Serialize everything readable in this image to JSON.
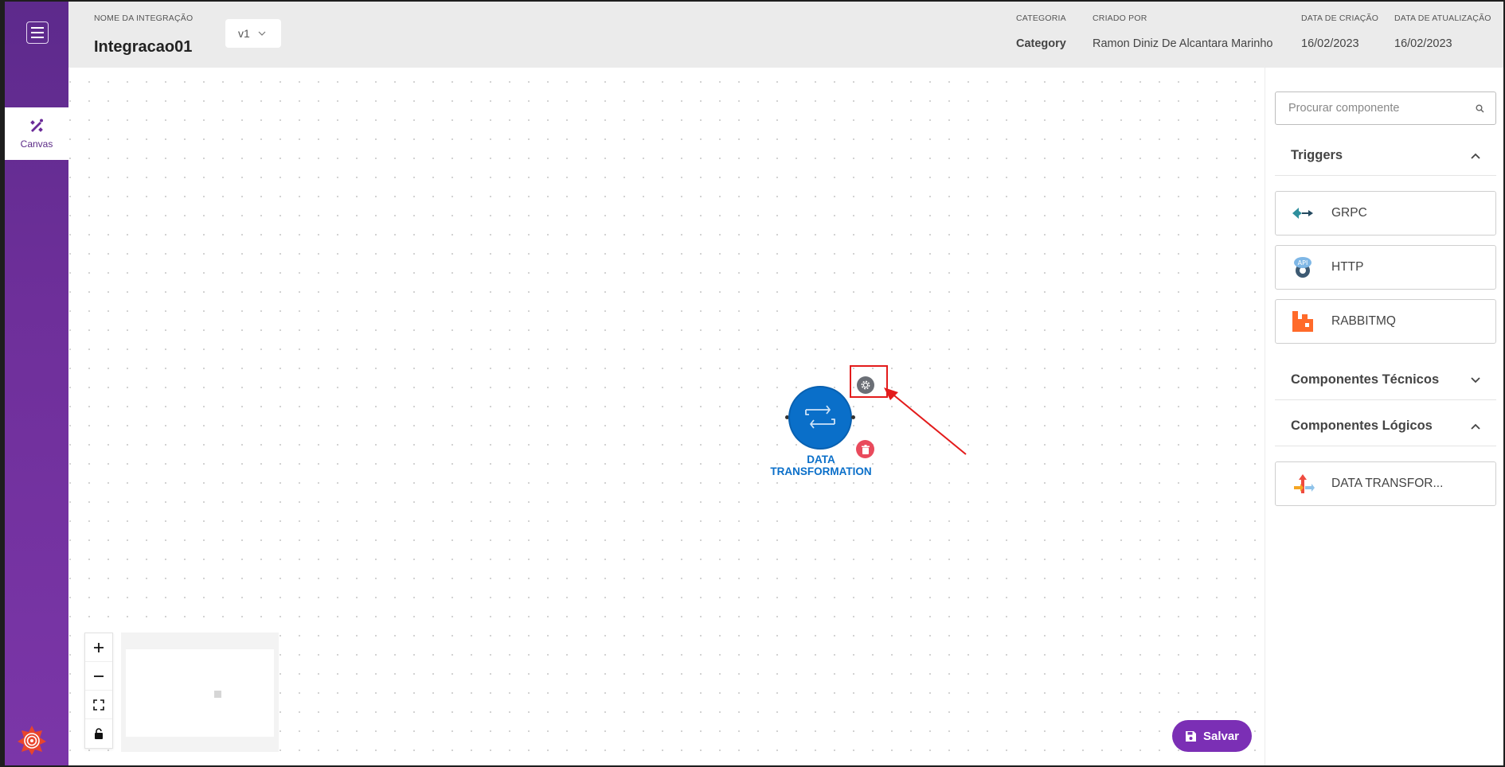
{
  "header": {
    "integration_label": "NOME DA INTEGRAÇÃO",
    "integration_name": "Integracao01",
    "version": "v1",
    "category_label": "CATEGORIA",
    "category_value": "Category",
    "created_by_label": "CRIADO POR",
    "created_by_value": "Ramon Diniz De Alcantara Marinho",
    "created_date_label": "DATA DE CRIAÇÃO",
    "created_date_value": "16/02/2023",
    "updated_date_label": "DATA DE ATUALIZAÇÃO",
    "updated_date_value": "16/02/2023"
  },
  "sidebar": {
    "canvas_label": "Canvas"
  },
  "canvas": {
    "node_label_line1": "DATA",
    "node_label_line2": "TRANSFORMATION",
    "save_label": "Salvar"
  },
  "panel": {
    "search_placeholder": "Procurar componente",
    "triggers_title": "Triggers",
    "triggers": [
      "GRPC",
      "HTTP",
      "RABBITMQ"
    ],
    "tecnicos_title": "Componentes Técnicos",
    "logicos_title": "Componentes Lógicos",
    "logicos": [
      "DATA TRANSFOR..."
    ]
  },
  "colors": {
    "accent": "#7b2fb5",
    "node": "#0a6fc9",
    "delete": "#e94a5c",
    "annotation": "#e31b1b"
  },
  "icons": {
    "menu": "hamburger-icon",
    "canvas": "design-tools-icon",
    "settings": "gear-icon",
    "delete": "trash-icon",
    "search": "search-icon",
    "save": "floppy-disk-icon"
  }
}
